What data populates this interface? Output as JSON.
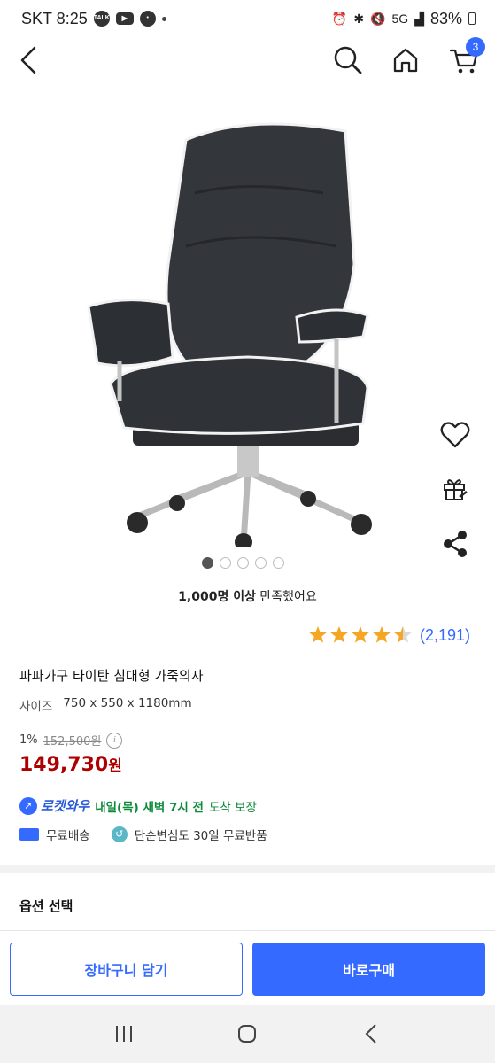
{
  "status_bar": {
    "carrier_time": "SKT 8:25",
    "apps": [
      "talk-icon",
      "youtube-icon",
      "chat-bubble-icon"
    ],
    "talk_label": "TALK",
    "network": "5G",
    "battery": "83%"
  },
  "nav": {
    "cart_count": "3"
  },
  "carousel": {
    "total": 5,
    "active_index": 0
  },
  "satisfaction": {
    "count": "1,000명 이상",
    "suffix": " 만족했어요"
  },
  "rating": {
    "stars": 4.5,
    "count": "(2,191)"
  },
  "product": {
    "title": "파파가구 타이탄 침대형 가죽의자",
    "size_label": "사이즈",
    "size_value": "750 x 550 x 1180mm"
  },
  "price": {
    "discount": "1%",
    "original": "152,500원",
    "sale": "149,730",
    "sale_unit": "원"
  },
  "delivery": {
    "rocket_label": "로켓와우",
    "arrival_bold": "내일(목) 새벽 7시 전",
    "arrival_suffix": "도착 보장",
    "free_shipping": "무료배송",
    "free_return": "단순변심도 30일 무료반품"
  },
  "options": {
    "title": "옵션 선택"
  },
  "actions": {
    "add_to_cart": "장바구니 담기",
    "buy_now": "바로구매"
  },
  "colors": {
    "accent": "#346aff",
    "price_red": "#ae0000",
    "star": "#f5a623",
    "green": "#0d8a3a"
  }
}
